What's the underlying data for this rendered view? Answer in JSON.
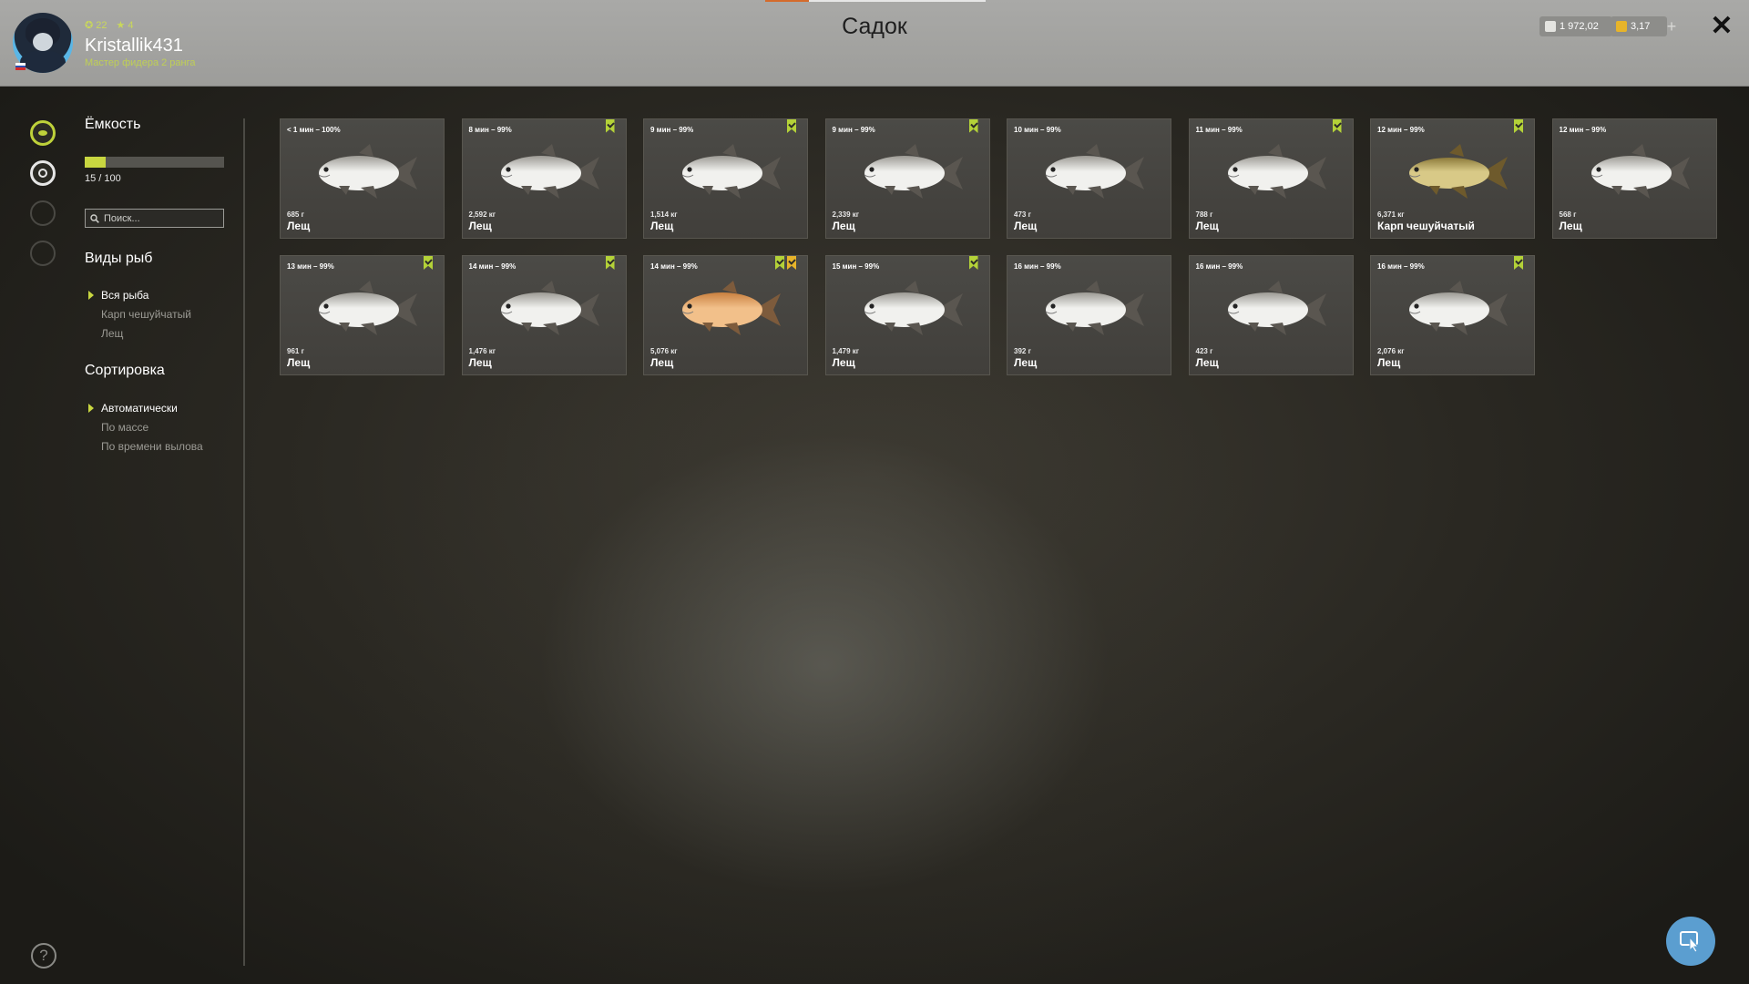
{
  "header": {
    "title": "Садок",
    "username": "Kristallik431",
    "rank": "Мастер фидера 2 ранга",
    "level": "22",
    "stars": "4",
    "currency_silver": "1 972,02",
    "currency_gold": "3,17",
    "add_label": "+",
    "close_label": "✕"
  },
  "colors": {
    "accent": "#c8d640",
    "header_bg": "#a4a4a1",
    "card_bg": "#46443f",
    "ribbon_green": "#b4d238",
    "ribbon_gold": "#e7b42a"
  },
  "sidebar": {
    "capacity_title": "Ёмкость",
    "capacity_text": "15 / 100",
    "capacity_fraction": 0.15,
    "search_placeholder": "Поиск...",
    "species_title": "Виды рыб",
    "species": [
      {
        "label": "Вся рыба",
        "selected": true
      },
      {
        "label": "Карп чешуйчатый",
        "selected": false
      },
      {
        "label": "Лещ",
        "selected": false
      }
    ],
    "sort_title": "Сортировка",
    "sort": [
      {
        "label": "Автоматически",
        "selected": true
      },
      {
        "label": "По массе",
        "selected": false
      },
      {
        "label": "По времени вылова",
        "selected": false
      }
    ],
    "help_label": "?"
  },
  "fish": [
    {
      "time": "< 1 мин – 100%",
      "weight": "685 г",
      "name": "Лещ",
      "green": false,
      "gold": false,
      "kind": "bream"
    },
    {
      "time": "8 мин – 99%",
      "weight": "2,592 кг",
      "name": "Лещ",
      "green": true,
      "gold": false,
      "kind": "bream"
    },
    {
      "time": "9 мин – 99%",
      "weight": "1,514 кг",
      "name": "Лещ",
      "green": true,
      "gold": false,
      "kind": "bream"
    },
    {
      "time": "9 мин – 99%",
      "weight": "2,339 кг",
      "name": "Лещ",
      "green": true,
      "gold": false,
      "kind": "bream"
    },
    {
      "time": "10 мин – 99%",
      "weight": "473 г",
      "name": "Лещ",
      "green": false,
      "gold": false,
      "kind": "bream"
    },
    {
      "time": "11 мин – 99%",
      "weight": "788 г",
      "name": "Лещ",
      "green": true,
      "gold": false,
      "kind": "bream"
    },
    {
      "time": "12 мин – 99%",
      "weight": "6,371 кг",
      "name": "Карп чешуйчатый",
      "green": true,
      "gold": false,
      "kind": "carp"
    },
    {
      "time": "12 мин – 99%",
      "weight": "568 г",
      "name": "Лещ",
      "green": false,
      "gold": false,
      "kind": "bream"
    },
    {
      "time": "13 мин – 99%",
      "weight": "961 г",
      "name": "Лещ",
      "green": true,
      "gold": false,
      "kind": "bream"
    },
    {
      "time": "14 мин – 99%",
      "weight": "1,476 кг",
      "name": "Лещ",
      "green": true,
      "gold": false,
      "kind": "bream"
    },
    {
      "time": "14 мин – 99%",
      "weight": "5,076 кг",
      "name": "Лещ",
      "green": true,
      "gold": true,
      "kind": "golden"
    },
    {
      "time": "15 мин – 99%",
      "weight": "1,479 кг",
      "name": "Лещ",
      "green": true,
      "gold": false,
      "kind": "bream"
    },
    {
      "time": "16 мин – 99%",
      "weight": "392 г",
      "name": "Лещ",
      "green": false,
      "gold": false,
      "kind": "bream"
    },
    {
      "time": "16 мин – 99%",
      "weight": "423 г",
      "name": "Лещ",
      "green": false,
      "gold": false,
      "kind": "bream"
    },
    {
      "time": "16 мин – 99%",
      "weight": "2,076 кг",
      "name": "Лещ",
      "green": true,
      "gold": false,
      "kind": "bream"
    }
  ]
}
